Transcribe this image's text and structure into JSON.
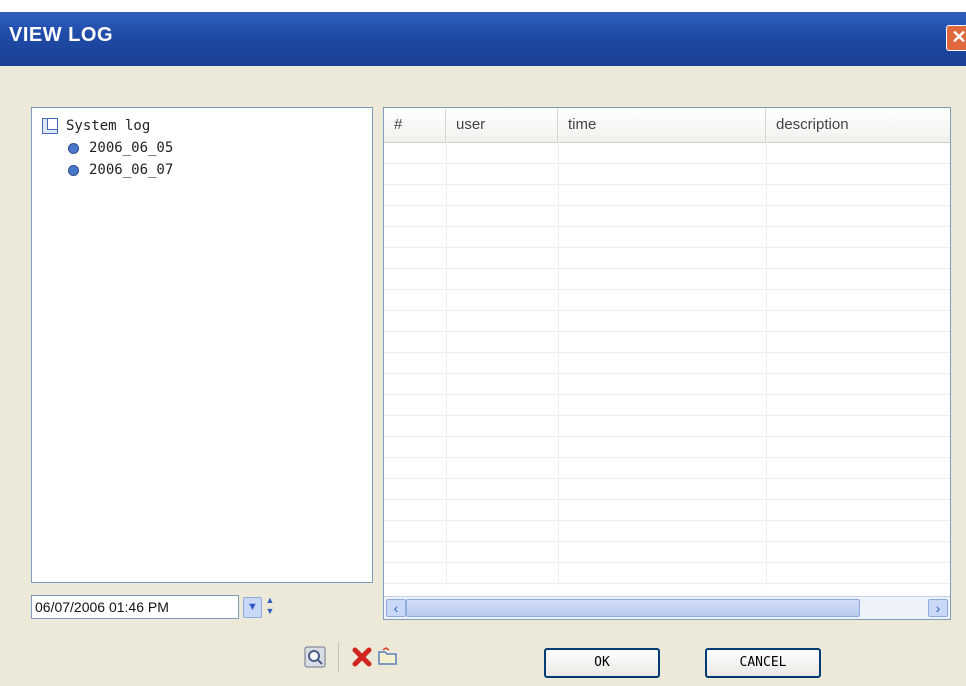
{
  "window": {
    "title": "VIEW LOG",
    "close_label": "✕"
  },
  "tree": {
    "root_label": "System log",
    "children": [
      {
        "label": "2006_06_05"
      },
      {
        "label": "2006_06_07"
      }
    ]
  },
  "table": {
    "columns": [
      "#",
      "user",
      "time",
      "description"
    ],
    "rows": []
  },
  "date_picker": {
    "value": "06/07/2006 01:46 PM"
  },
  "toolbar": {
    "icons": [
      "view-icon",
      "delete-icon",
      "open-folder-icon"
    ]
  },
  "buttons": {
    "ok": "OK",
    "cancel": "CANCEL"
  },
  "colors": {
    "titlebar": "#1f4aa6",
    "window_bg": "#ece9d8",
    "close": "#e0683d",
    "button_border": "#003c74"
  }
}
